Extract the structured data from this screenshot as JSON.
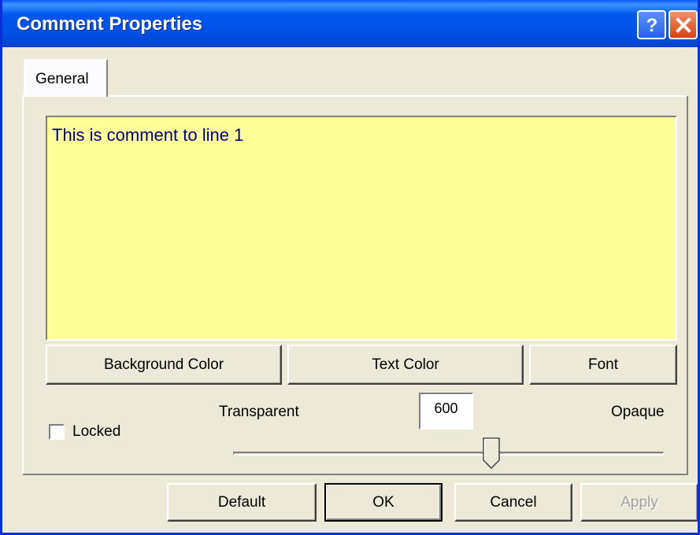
{
  "window": {
    "title": "Comment Properties"
  },
  "title_buttons": {
    "help_icon": "help-icon",
    "close_icon": "close-icon"
  },
  "tabs": [
    {
      "label": "General"
    }
  ],
  "comment": {
    "text": "This is comment to line 1",
    "background_color": "#ffff99",
    "text_color": "#000080"
  },
  "style_buttons": {
    "background_color": "Background Color",
    "text_color": "Text Color",
    "font": "Font"
  },
  "locked": {
    "label": "Locked",
    "checked": false
  },
  "transparency": {
    "min_label": "Transparent",
    "max_label": "Opaque",
    "value": "600",
    "slider_fraction": 0.6
  },
  "footer_buttons": {
    "default": "Default",
    "ok": "OK",
    "cancel": "Cancel",
    "apply": "Apply"
  },
  "colors": {
    "title_bar": "#0054e3",
    "face": "#ece9d8",
    "close_button": "#d9420f"
  }
}
